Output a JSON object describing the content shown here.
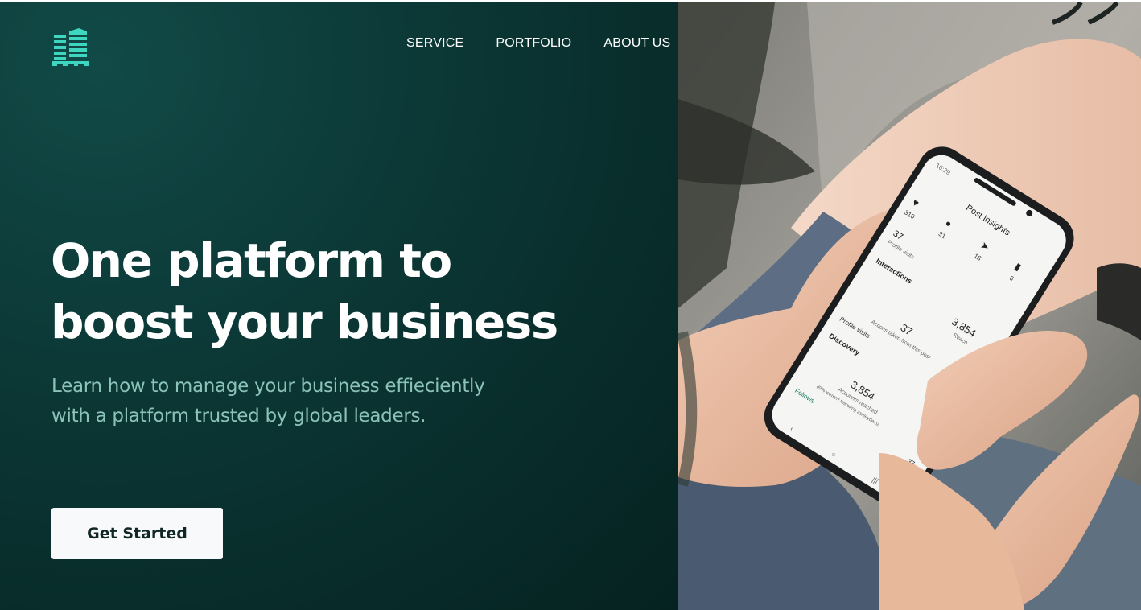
{
  "nav": {
    "items": [
      {
        "label": "SERVICE"
      },
      {
        "label": "PORTFOLIO"
      },
      {
        "label": "ABOUT US"
      }
    ]
  },
  "hero": {
    "headline_line1": "One platform to",
    "headline_line2": "boost your business",
    "subtext_line1": "Learn how to manage your business effieciently",
    "subtext_line2": "with a platform trusted by global leaders.",
    "cta_label": "Get Started"
  },
  "phone": {
    "status_time": "16:29",
    "title": "Post insights",
    "stats": [
      "310",
      "31",
      "18",
      "6"
    ],
    "profile_visits_value": "37",
    "profile_visits_label": "Profile visits",
    "interactions_label": "Interactions",
    "reach_value": "3,854",
    "reach_label": "Reach",
    "actions_value": "37",
    "actions_label": "Actions taken from this post",
    "profile_visits_row_label": "Profile visits",
    "discovery_label": "Discovery",
    "accounts_reached_value": "3,854",
    "accounts_reached_label": "Accounts reached",
    "not_following_label": "89% weren't following ashleydeloz",
    "follows_label": "Follows",
    "follows_value": "37",
    "extra_value": "3"
  },
  "colors": {
    "hero_bg": "#0b3634",
    "accent": "#3ed6c0",
    "subtext": "#8cc3b9",
    "cta_bg": "#f7f9fb",
    "cta_text": "#102724"
  },
  "icons": {
    "logo": "buildings-logo-icon"
  }
}
